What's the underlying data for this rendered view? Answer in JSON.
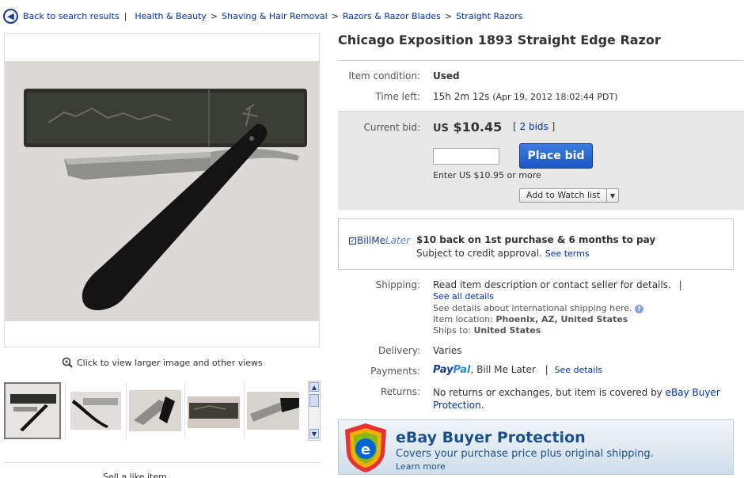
{
  "breadcrumb": {
    "back_label": "Back to search results",
    "separator": "|",
    "arrow": ">",
    "items": [
      "Health & Beauty",
      "Shaving & Hair Removal",
      "Razors & Razor Blades",
      "Straight Razors"
    ]
  },
  "gallery": {
    "zoom_label": "Click to view larger image and other views",
    "cut_off_text": "Sell a like item"
  },
  "item": {
    "title": "Chicago Exposition 1893 Straight Edge Razor",
    "condition_label": "Item condition:",
    "condition_value": "Used",
    "time_left_label": "Time left:",
    "time_left_value": "15h 2m 12s",
    "time_left_end": "(Apr 19, 2012 18:02:44 PDT)"
  },
  "bid": {
    "current_bid_label": "Current bid:",
    "currency": "US",
    "amount": "$10.45",
    "bids_link": "2 bids",
    "bid_input_value": "",
    "place_bid_label": "Place bid",
    "enter_min": "Enter US $10.95 or more",
    "watch_label": "Add to Watch list"
  },
  "bill_me_later": {
    "logo_bill": "Bill",
    "logo_me": "Me",
    "logo_later": "Later",
    "headline": "$10 back on 1st purchase & 6 months to pay",
    "sub": "Subject to credit approval.",
    "see_terms": "See terms"
  },
  "shipping": {
    "label": "Shipping:",
    "value": "Read item description or contact seller for details.",
    "pipe": "|",
    "see_all": "See all details",
    "intl": "See details about international shipping here.",
    "location_label": "Item location:",
    "location_value": "Phoenix, AZ, United States",
    "ships_to_label": "Ships to:",
    "ships_to_value": "United States"
  },
  "delivery": {
    "label": "Delivery:",
    "value": "Varies"
  },
  "payments": {
    "label": "Payments:",
    "paypal_pay": "Pay",
    "paypal_pal": "Pal",
    "rest": ", Bill Me Later",
    "pipe": "|",
    "see_details": "See details"
  },
  "returns": {
    "label": "Returns:",
    "text": "No returns or exchanges, but item is covered by",
    "link": "eBay Buyer Protection",
    "period": "."
  },
  "buyer_protection": {
    "title": "eBay Buyer Protection",
    "sub": "Covers your purchase price plus original shipping.",
    "link": "Learn more"
  },
  "icons": [
    "back-arrow-icon",
    "zoom-icon",
    "scroll-up-icon",
    "scroll-down-icon",
    "dropdown-icon",
    "help-icon",
    "check-icon",
    "shield-icon"
  ]
}
